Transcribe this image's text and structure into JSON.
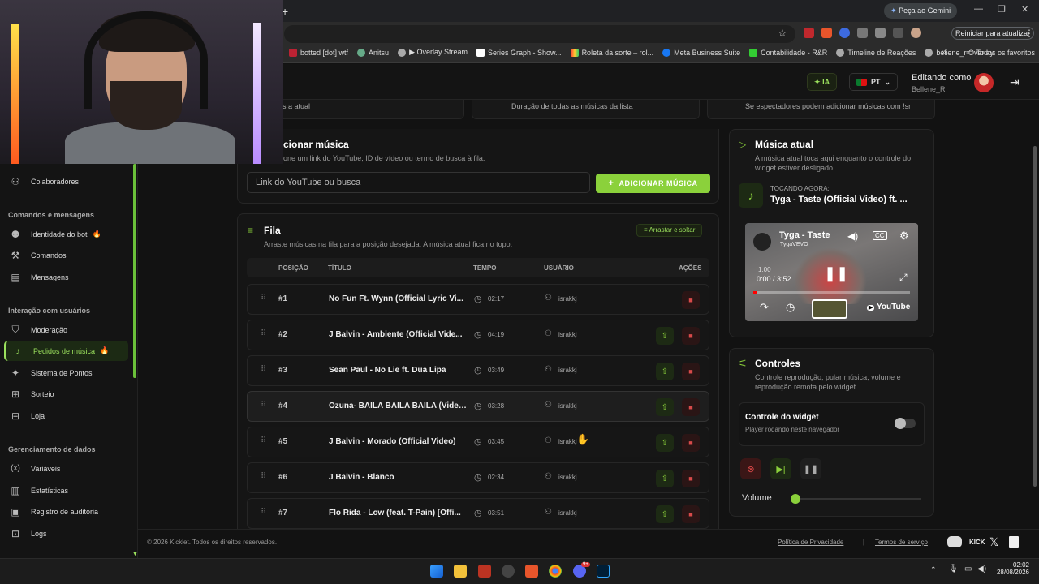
{
  "browser": {
    "newtab": "+",
    "gemini": "Peça ao Gemini",
    "update": "Reiniciar para atualizar",
    "all_bookmarks": "Todos os favoritos",
    "bookmarks": [
      "botted [dot] wtf",
      "Anitsu",
      "▶ Overlay Stream",
      "Series Graph - Show...",
      "Roleta da sorte – rol...",
      "Meta Business Suite",
      "Contabilidade - R&R",
      "Timeline de Reações",
      "beliene_r Overlay"
    ]
  },
  "header": {
    "ia": "IA",
    "lang": "PT",
    "editing_label": "Editando como",
    "editing_user": "Bellene_R"
  },
  "sidebar": {
    "collab": "Colaboradores",
    "sec_commands": "Comandos e mensagens",
    "bot_identity": "Identidade do bot",
    "commands": "Comandos",
    "messages": "Mensagens",
    "sec_interaction": "Interação com usuários",
    "moderation": "Moderação",
    "song_requests": "Pedidos de música",
    "points": "Sistema de Pontos",
    "raffle": "Sorteio",
    "store": "Loja",
    "sec_data": "Gerenciamento de dados",
    "variables": "Variáveis",
    "statistics": "Estatísticas",
    "audit": "Registro de auditoria",
    "logs": "Logs"
  },
  "stats": {
    "s1": "úsicas após a atual",
    "s2": "Duração de todas as músicas da lista",
    "s3": "Se espectadores podem adicionar músicas com !sr"
  },
  "add": {
    "title": "cionar música",
    "sub": "one um link do YouTube, ID de vídeo ou termo de busca à fila.",
    "placeholder": "Link do YouTube ou busca",
    "button": "ADICIONAR MÚSICA"
  },
  "queue": {
    "title": "Fila",
    "sub": "Arraste músicas na fila para a posição desejada. A música atual fica no topo.",
    "drag": "Arrastar e soltar",
    "cols": {
      "pos": "POSIÇÃO",
      "title": "TÍTULO",
      "time": "TEMPO",
      "user": "USUÁRIO",
      "actions": "AÇÕES"
    },
    "rows": [
      {
        "pos": "#1",
        "title": "No Fun Ft. Wynn (Official Lyric Vi...",
        "time": "02:17",
        "user": "israkkj"
      },
      {
        "pos": "#2",
        "title": "J Balvin - Ambiente (Official Vide...",
        "time": "04:19",
        "user": "israkkj"
      },
      {
        "pos": "#3",
        "title": "Sean Paul - No Lie ft. Dua Lipa",
        "time": "03:49",
        "user": "israkkj"
      },
      {
        "pos": "#4",
        "title": "Ozuna- BAILA BAILA BAILA (Video...",
        "time": "03:28",
        "user": "israkkj"
      },
      {
        "pos": "#5",
        "title": "J Balvin - Morado (Official Video)",
        "time": "03:45",
        "user": "israkkj"
      },
      {
        "pos": "#6",
        "title": "J Balvin - Blanco",
        "time": "02:34",
        "user": "israkkj"
      },
      {
        "pos": "#7",
        "title": "Flo Rida - Low (feat. T-Pain) [Offi...",
        "time": "03:51",
        "user": "israkkj"
      }
    ]
  },
  "current": {
    "title": "Música atual",
    "sub": "A música atual toca aqui enquanto o controle do widget estiver desligado.",
    "now_label": "TOCANDO AGORA:",
    "now_song": "Tyga - Taste (Official Video) ft. ...",
    "yt_title": "Tyga - Taste",
    "yt_channel": "TygaVEVO",
    "yt_rate": "1.00",
    "yt_time": "0:00 / 3:52",
    "yt_brand": "YouTube",
    "progress": 0.02
  },
  "controls": {
    "title": "Controles",
    "sub": "Controle reprodução, pular música, volume e reprodução remota pelo widget.",
    "widget_title": "Controle do widget",
    "widget_sub": "Player rodando neste navegador",
    "volume": "Volume",
    "volume_level": 0.0
  },
  "footer": {
    "copyright": "© 2026 Kicklet. Todos os direitos reservados.",
    "privacy": "Política de Privacidade",
    "sep": "|",
    "terms": "Termos de serviço",
    "kick": "KICK"
  },
  "taskbar": {
    "time": "02:02",
    "date": "28/08/2026",
    "discord_badge": "9+"
  },
  "colors": {
    "accent": "#8bd13b",
    "danger": "#d84a4a",
    "bg": "#121212"
  }
}
